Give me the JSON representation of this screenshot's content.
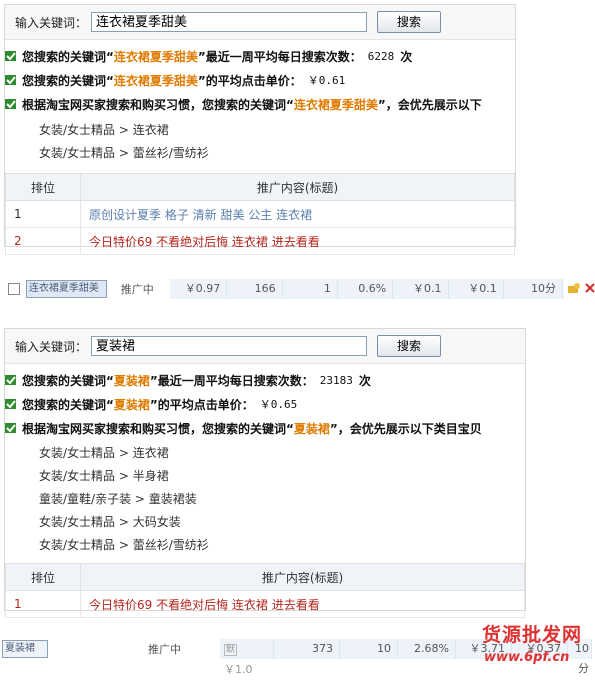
{
  "panel1": {
    "search_label": "输入关键词：",
    "search_value": "连衣裙夏季甜美",
    "search_button": "搜索",
    "line1_pre": "您搜索的关键词“",
    "line1_kw": "连衣裙夏季甜美",
    "line1_post": "”最近一周平均每日搜索次数：",
    "line1_num": "6228",
    "line1_unit": "次",
    "line2_pre": "您搜索的关键词“",
    "line2_kw": "连衣裙夏季甜美",
    "line2_post": "”的平均点击单价：",
    "line2_num": "￥0.61",
    "line3_pre": "根据淘宝网买家搜索和购买习惯，您搜索的关键词“",
    "line3_kw": "连衣裙夏季甜美",
    "line3_post": "”，会优先展示以下",
    "categories": [
      "女装/女士精品 > 连衣裙",
      "女装/女士精品 > 蕾丝衫/雪纺衫"
    ],
    "col_rank": "排位",
    "col_content": "推广内容(标题)",
    "rows": [
      {
        "rank": "1",
        "text": "原创设计夏季 格子 清新 甜美 公主 连衣裙"
      },
      {
        "rank": "2",
        "text": "今日特价69 不看绝对后悔 连衣裙 进去看看"
      }
    ]
  },
  "strip1": {
    "keyword": "连衣裙夏季甜美",
    "status": "推广中",
    "price": "￥0.97",
    "c1": "166",
    "c2": "1",
    "c3": "0.6%",
    "c4": "￥0.1",
    "c5": "￥0.1",
    "c6": "10分"
  },
  "panel2": {
    "search_label": "输入关键词：",
    "search_value": "夏装裙",
    "search_button": "搜索",
    "line1_pre": "您搜索的关键词“",
    "line1_kw": "夏装裙",
    "line1_post": "”最近一周平均每日搜索次数：",
    "line1_num": "23183",
    "line1_unit": "次",
    "line2_pre": "您搜索的关键词“",
    "line2_kw": "夏装裙",
    "line2_post": "”的平均点击单价：",
    "line2_num": "￥0.65",
    "line3_pre": "根据淘宝网买家搜索和购买习惯，您搜索的关键词“",
    "line3_kw": "夏装裙",
    "line3_post": "”，会优先展示以下类目宝贝",
    "categories": [
      "女装/女士精品 > 连衣裙",
      "女装/女士精品 > 半身裙",
      "童装/童鞋/亲子装 > 童装裙装",
      "女装/女士精品 > 大码女装",
      "女装/女士精品 > 蕾丝衫/雪纺衫"
    ],
    "col_rank": "排位",
    "col_content": "推广内容(标题)",
    "rows": [
      {
        "rank": "1",
        "text": "今日特价69 不看绝对后悔 连衣裙 进去看看"
      }
    ]
  },
  "strip2": {
    "keyword": "夏装裙",
    "status": "推广中",
    "tag": "默",
    "price": "￥1.0",
    "c1": "373",
    "c2": "10",
    "c3": "2.68%",
    "c4": "￥3.71",
    "c5": "￥0.37",
    "c6": "10分"
  },
  "watermark": {
    "line1": "货源批发网",
    "line2": "www.6pf.cn"
  }
}
